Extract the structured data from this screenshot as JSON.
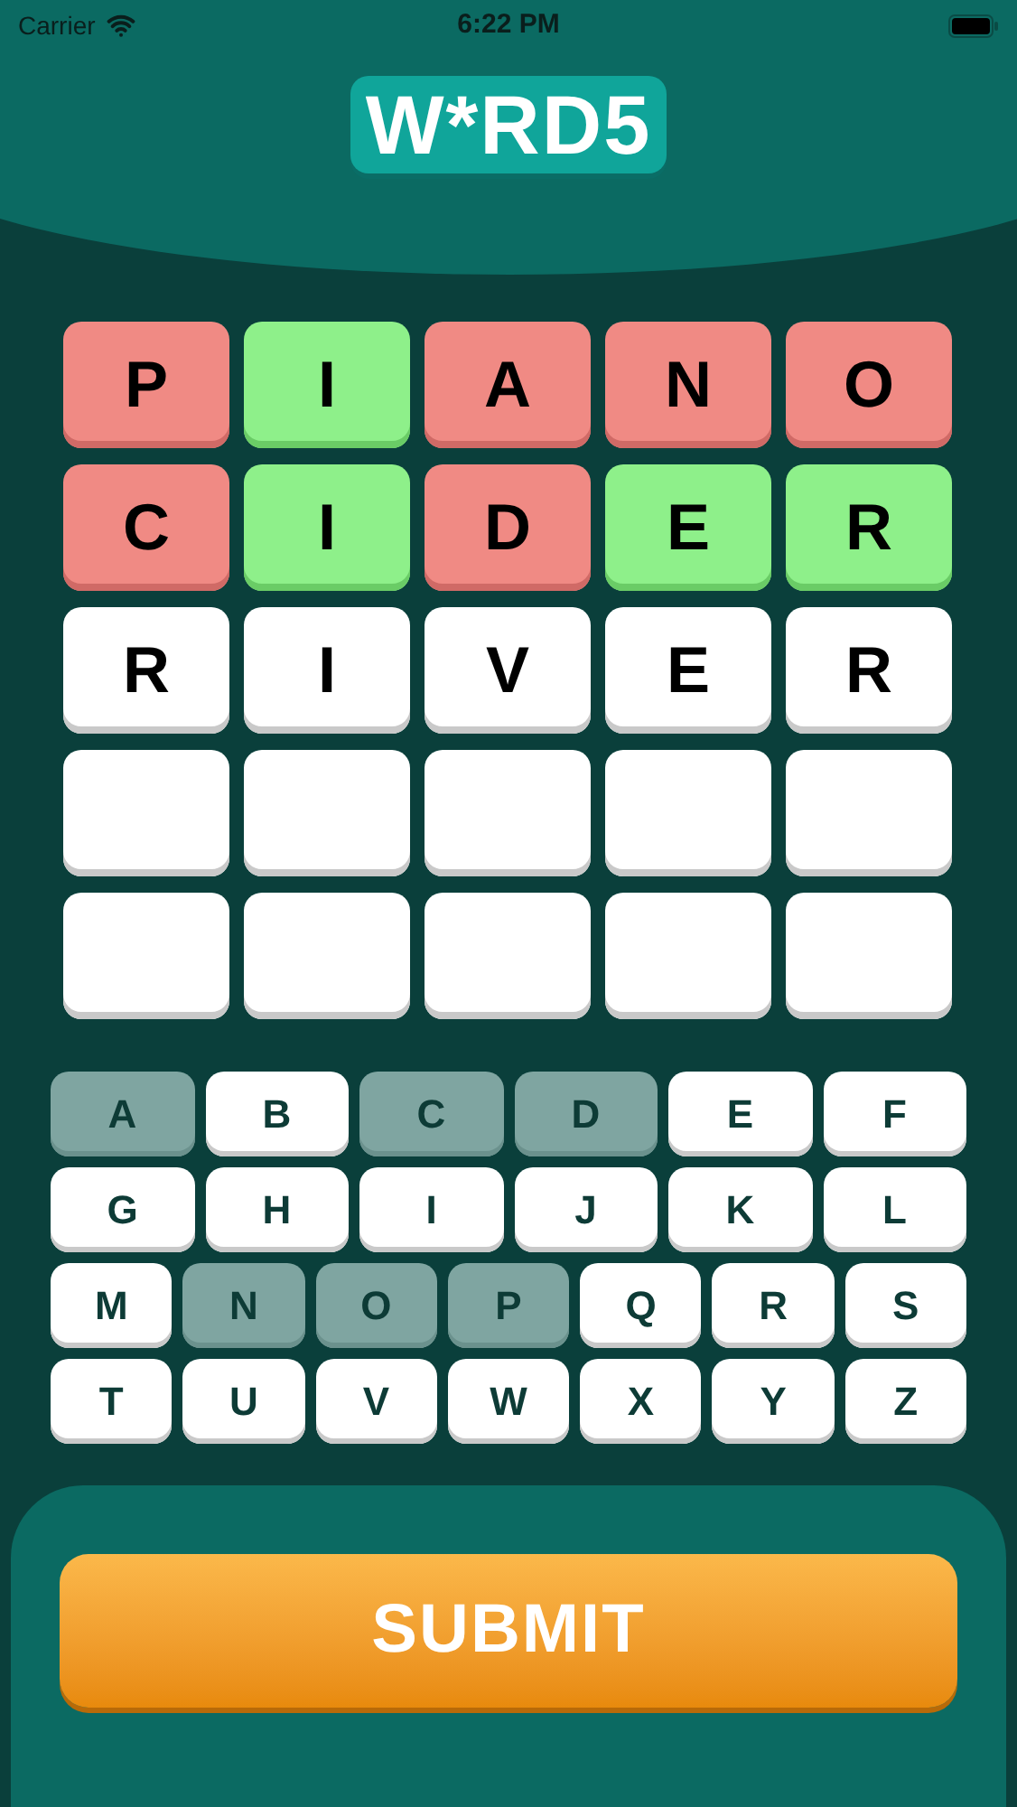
{
  "status_bar": {
    "carrier": "Carrier",
    "time": "6:22 PM"
  },
  "logo": "W*RD5",
  "grid": [
    [
      {
        "letter": "P",
        "kind": "absent"
      },
      {
        "letter": "I",
        "kind": "correct"
      },
      {
        "letter": "A",
        "kind": "absent"
      },
      {
        "letter": "N",
        "kind": "absent"
      },
      {
        "letter": "O",
        "kind": "absent"
      }
    ],
    [
      {
        "letter": "C",
        "kind": "absent"
      },
      {
        "letter": "I",
        "kind": "correct"
      },
      {
        "letter": "D",
        "kind": "absent"
      },
      {
        "letter": "E",
        "kind": "correct"
      },
      {
        "letter": "R",
        "kind": "correct"
      }
    ],
    [
      {
        "letter": "R",
        "kind": "typed"
      },
      {
        "letter": "I",
        "kind": "typed"
      },
      {
        "letter": "V",
        "kind": "typed"
      },
      {
        "letter": "E",
        "kind": "typed"
      },
      {
        "letter": "R",
        "kind": "typed"
      }
    ],
    [
      {
        "kind": "empty"
      },
      {
        "kind": "empty"
      },
      {
        "kind": "empty"
      },
      {
        "kind": "empty"
      },
      {
        "kind": "empty"
      }
    ],
    [
      {
        "kind": "empty"
      },
      {
        "kind": "empty"
      },
      {
        "kind": "empty"
      },
      {
        "kind": "empty"
      },
      {
        "kind": "empty"
      }
    ]
  ],
  "keyboard": [
    [
      {
        "key": "A",
        "used": true
      },
      {
        "key": "B",
        "used": false
      },
      {
        "key": "C",
        "used": true
      },
      {
        "key": "D",
        "used": true
      },
      {
        "key": "E",
        "used": false
      },
      {
        "key": "F",
        "used": false
      }
    ],
    [
      {
        "key": "G",
        "used": false
      },
      {
        "key": "H",
        "used": false
      },
      {
        "key": "I",
        "used": false
      },
      {
        "key": "J",
        "used": false
      },
      {
        "key": "K",
        "used": false
      },
      {
        "key": "L",
        "used": false
      }
    ],
    [
      {
        "key": "M",
        "used": false
      },
      {
        "key": "N",
        "used": true
      },
      {
        "key": "O",
        "used": true
      },
      {
        "key": "P",
        "used": true
      },
      {
        "key": "Q",
        "used": false
      },
      {
        "key": "R",
        "used": false
      },
      {
        "key": "S",
        "used": false
      }
    ],
    [
      {
        "key": "T",
        "used": false
      },
      {
        "key": "U",
        "used": false
      },
      {
        "key": "V",
        "used": false
      },
      {
        "key": "W",
        "used": false
      },
      {
        "key": "X",
        "used": false
      },
      {
        "key": "Y",
        "used": false
      },
      {
        "key": "Z",
        "used": false
      }
    ]
  ],
  "submit": "SUBMIT"
}
